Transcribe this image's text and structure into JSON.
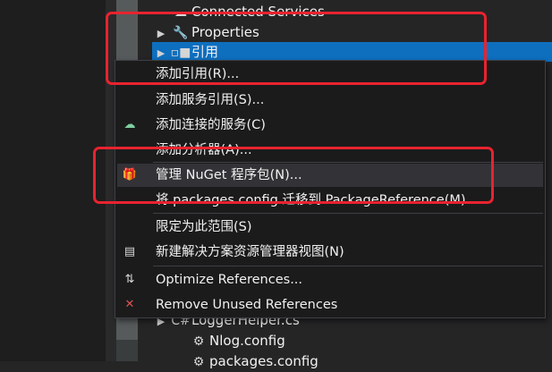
{
  "solution_explorer": {
    "items": [
      {
        "label": "Connected Services",
        "icon": "cloud-icon"
      },
      {
        "label": "Properties",
        "icon": "wrench-icon"
      },
      {
        "label": "引用",
        "icon": "references-icon"
      },
      {
        "label": "LoggerHelper.cs",
        "icon": "csharp-file-icon"
      },
      {
        "label": "Nlog.config",
        "icon": "config-file-icon"
      },
      {
        "label": "packages.config",
        "icon": "config-file-icon"
      }
    ]
  },
  "context_menu": {
    "items": [
      {
        "label": "添加引用(R)...",
        "icon": ""
      },
      {
        "label": "添加服务引用(S)...",
        "icon": ""
      },
      {
        "label": "添加连接的服务(C)",
        "icon": "connected-service-icon"
      },
      {
        "label": "添加分析器(A)...",
        "icon": ""
      },
      {
        "label": "管理 NuGet 程序包(N)...",
        "icon": "nuget-package-icon"
      },
      {
        "label": "将 packages.config 迁移到 PackageReference(M)...",
        "icon": ""
      },
      {
        "label": "限定为此范围(S)",
        "icon": ""
      },
      {
        "label": "新建解决方案资源管理器视图(N)",
        "icon": "new-view-icon"
      },
      {
        "label": "Optimize References...",
        "icon": "optimize-icon"
      },
      {
        "label": "Remove Unused References",
        "icon": "remove-references-icon"
      }
    ]
  },
  "colors": {
    "selection": "#0e6fbf",
    "menu_background": "#1b1b1c",
    "menu_highlight": "#333337",
    "annotation": "#e8232f"
  }
}
